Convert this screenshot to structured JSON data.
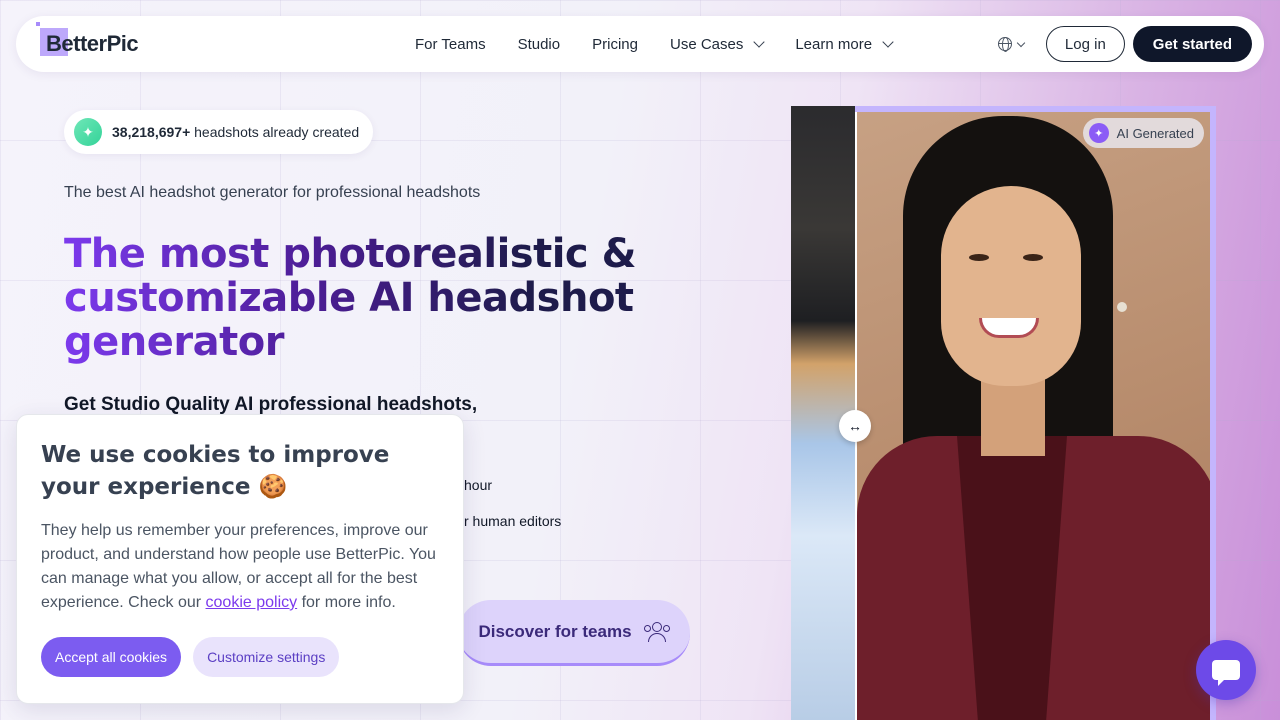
{
  "brand": {
    "name": "BetterPic"
  },
  "nav": {
    "links": [
      {
        "label": "For Teams"
      },
      {
        "label": "Studio"
      },
      {
        "label": "Pricing"
      },
      {
        "label": "Use Cases"
      },
      {
        "label": "Learn more"
      }
    ],
    "login_label": "Log in",
    "start_label": "Get started"
  },
  "hero": {
    "counter_value": "38,218,697+",
    "counter_suffix": " headshots already created",
    "tagline": "The best AI headshot generator for professional headshots",
    "headline": "The most photorealistic & customizable AI headshot generator",
    "subhead": "Get Studio Quality AI professional headshots,",
    "bullet1_partial": "hour",
    "bullet2_partial": "r human editors",
    "teams_button": "Discover for teams"
  },
  "cookie": {
    "title": "We use cookies to improve your experience 🍪",
    "body_before": "They help us remember your preferences, improve our product, and understand how people use BetterPic. You can manage what you allow, or accept all for the best experience. Check our ",
    "link": "cookie policy",
    "body_after": " for more info.",
    "accept_label": "Accept all cookies",
    "customize_label": "Customize settings"
  },
  "compare": {
    "badge": "AI Generated",
    "handle_glyph": "↔"
  },
  "colors": {
    "accent": "#7c5cf0",
    "dark": "#0f172a",
    "frame": "#c4b5fd"
  }
}
